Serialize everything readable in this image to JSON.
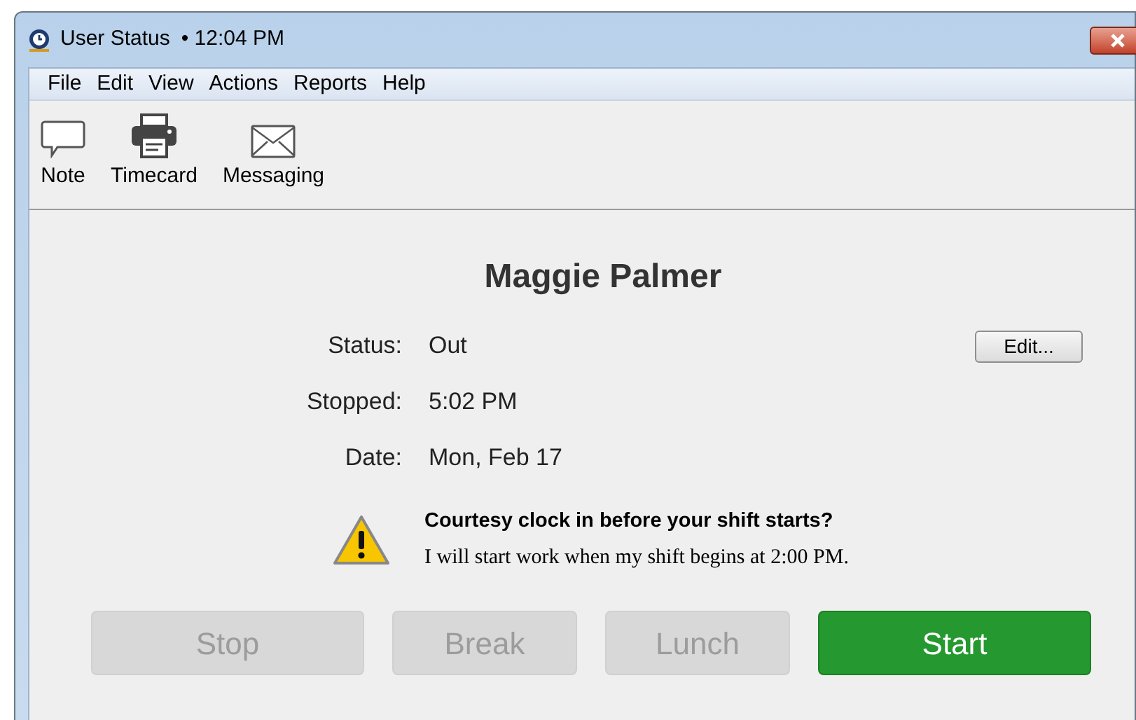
{
  "window": {
    "title": "User Status",
    "time": "• 12:04 PM"
  },
  "menu": [
    "File",
    "Edit",
    "View",
    "Actions",
    "Reports",
    "Help"
  ],
  "toolbar": [
    {
      "kind": "note",
      "label": "Note"
    },
    {
      "kind": "timecard",
      "label": "Timecard"
    },
    {
      "kind": "messaging",
      "label": "Messaging"
    }
  ],
  "user": {
    "name": "Maggie Palmer"
  },
  "fields": [
    {
      "label": "Status:",
      "value": "Out"
    },
    {
      "label": "Stopped:",
      "value": "5:02 PM"
    },
    {
      "label": "Date:",
      "value": "Mon, Feb 17"
    }
  ],
  "edit_button": "Edit...",
  "warning": {
    "title": "Courtesy clock in before your shift starts?",
    "text": "I will start work when my shift begins at 2:00 PM."
  },
  "buttons": [
    {
      "label": "Stop",
      "disabled": true
    },
    {
      "label": "Break",
      "disabled": true
    },
    {
      "label": "Lunch",
      "disabled": true
    },
    {
      "label": "Start",
      "disabled": false
    }
  ]
}
